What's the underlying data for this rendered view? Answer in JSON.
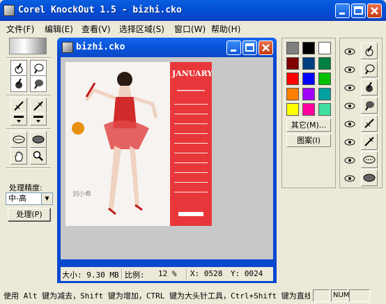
{
  "window": {
    "title": "Corel KnockOut 1.5 - bizhi.cko"
  },
  "menu": [
    {
      "label": "文件(F)"
    },
    {
      "label": "编辑(E)"
    },
    {
      "label": "查看(V)"
    },
    {
      "label": "选择区域(S)"
    },
    {
      "label": "窗口(W)"
    },
    {
      "label": "帮助(H)"
    }
  ],
  "left_panel": {
    "precision_label": "处理精度:",
    "precision_value": "中-高",
    "process_button": "处理(P)"
  },
  "document": {
    "title": "bizhi.cko",
    "image": {
      "calendar_month": "JANUARY",
      "caption_name": "刘小希"
    },
    "status": {
      "size": "大小: 9.30 MB",
      "scale_label": "比例:",
      "scale_value": "12 %",
      "x": "X: 0528",
      "y": "Y: 0024"
    }
  },
  "palette": {
    "colors": [
      "#808080",
      "#000000",
      "#ffffff",
      "#800000",
      "#004080",
      "#008040",
      "#ff0000",
      "#0000ff",
      "#00c000",
      "#ff8000",
      "#a000ff",
      "#00a0a0",
      "#ffff00",
      "#ff00a0",
      "#40e0a0"
    ],
    "other_button": "其它(M)...",
    "pattern_button": "图案(I)"
  },
  "status_bar": {
    "message": "使用 Alt 键为减去，Shift 键为增加，CTRL 键为大头针工具，Ctrl+Shift 键为直线",
    "num": "NUM"
  }
}
